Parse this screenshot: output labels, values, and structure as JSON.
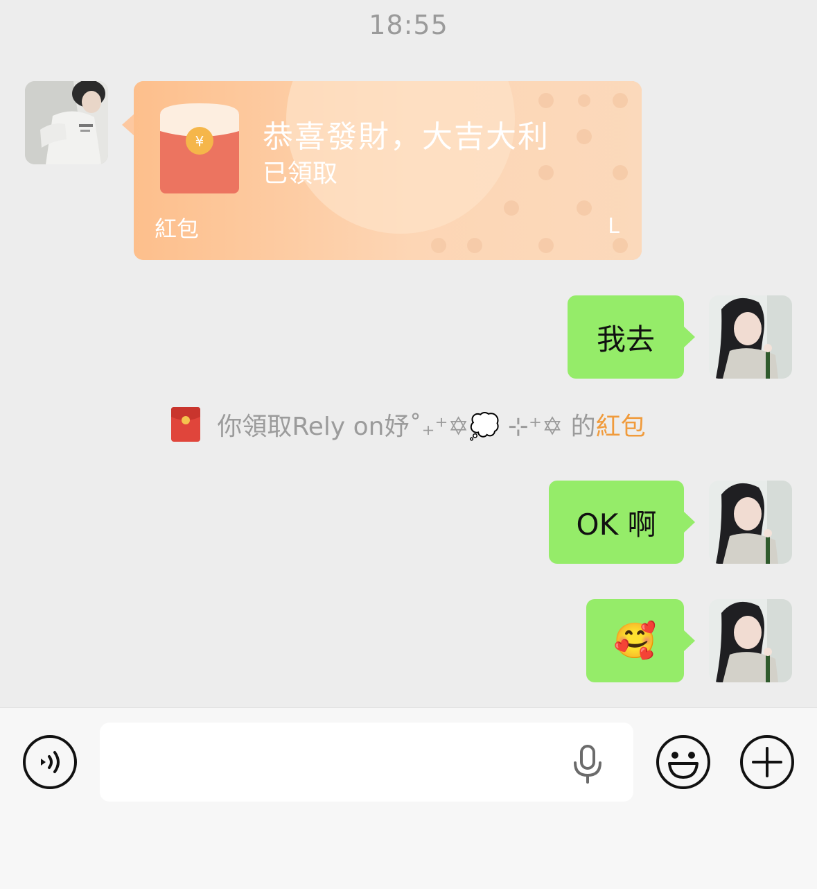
{
  "timestamp": "18:55",
  "red_packet": {
    "title": "恭喜發財，大吉大利",
    "status": "已領取",
    "label": "紅包",
    "corner": "L"
  },
  "messages": [
    {
      "text": "我去"
    },
    {
      "text": "OK 啊"
    },
    {
      "text": "🥰"
    }
  ],
  "system_notice": {
    "prefix": "你領取Rely on妤˚₊⁺✡💭 ⊹⁺✡ 的",
    "link": "紅包"
  },
  "input": {
    "placeholder": ""
  },
  "colors": {
    "background": "#ededed",
    "bubble_green": "#95ec69",
    "packet_orange": "#fcc89e",
    "accent": "#f09b3c"
  },
  "icons": [
    "voice-toggle-icon",
    "microphone-icon",
    "emoji-icon",
    "plus-icon",
    "red-envelope-icon"
  ]
}
